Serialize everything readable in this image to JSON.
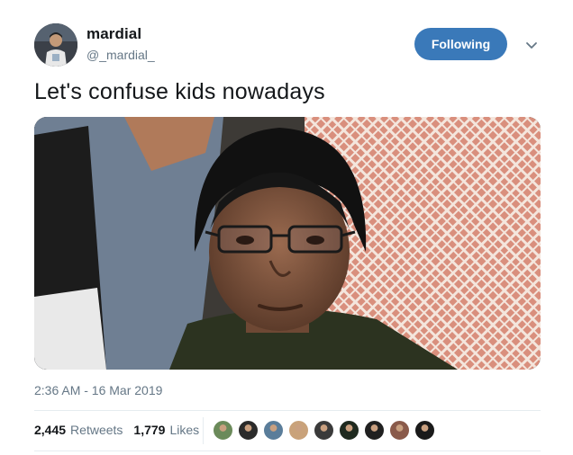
{
  "user": {
    "display_name": "mardial",
    "handle": "@_mardial_",
    "avatar_icon": "profile-photo"
  },
  "follow_button": {
    "label": "Following",
    "color": "#3a79b9"
  },
  "menu_icon": "chevron-down-icon",
  "tweet": {
    "text": "Let's confuse kids nowadays",
    "timestamp": "2:36 AM - 16 Mar 2019",
    "media_description": "photo"
  },
  "stats": {
    "retweets_count": "2,445",
    "retweets_label": "Retweets",
    "likes_count": "1,779",
    "likes_label": "Likes"
  },
  "likers": [
    {
      "color": "#6b8a5a"
    },
    {
      "color": "#2b2b2b"
    },
    {
      "color": "#5a7d9a"
    },
    {
      "color": "#c9a27a"
    },
    {
      "color": "#3a3a3a"
    },
    {
      "color": "#1f2a1f"
    },
    {
      "color": "#202020"
    },
    {
      "color": "#8a5a4a"
    },
    {
      "color": "#1a1a1a"
    }
  ],
  "colors": {
    "text": "#14171a",
    "secondary": "#657786",
    "accent": "#3a79b9"
  }
}
